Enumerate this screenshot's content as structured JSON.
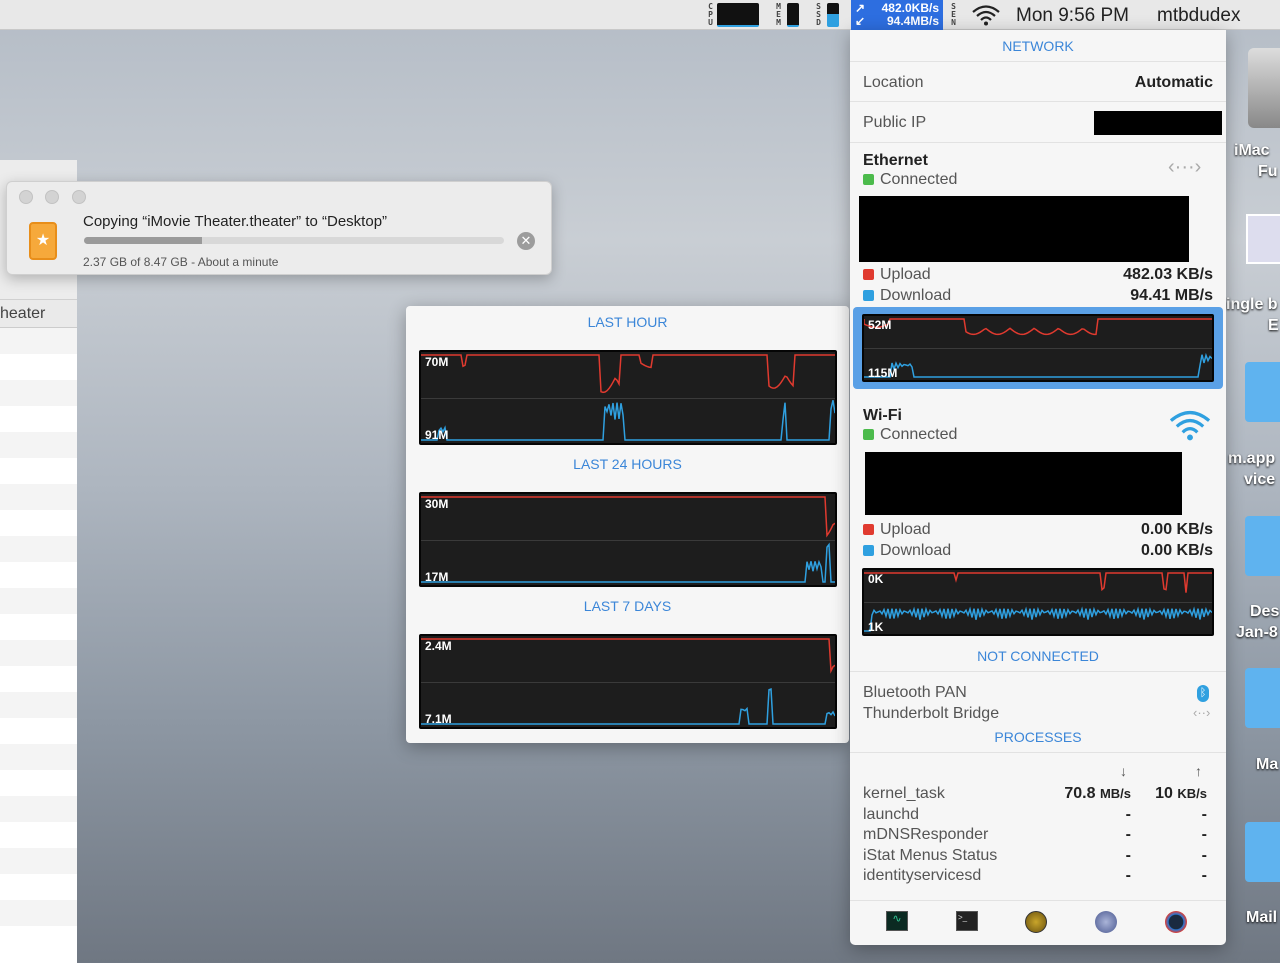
{
  "menubar": {
    "cpu_label": "CPU",
    "mem_label": "MEM",
    "ssd_label": "SSD",
    "sen_label": "SEN",
    "net_up": "482.0KB/s",
    "net_down": "94.4MB/s",
    "clock": "Mon 9:56 PM",
    "user": "mtbdudex"
  },
  "finder": {
    "partial_label": "heater"
  },
  "copy_dialog": {
    "title": "Copying “iMovie Theater.theater” to “Desktop”",
    "status": "2.37 GB of 8.47 GB - About a minute",
    "progress_fraction": 0.28
  },
  "history": {
    "sections": [
      {
        "title": "LAST HOUR",
        "top_label": "70M",
        "bottom_label": "91M"
      },
      {
        "title": "LAST 24 HOURS",
        "top_label": "30M",
        "bottom_label": "17M"
      },
      {
        "title": "LAST 7 DAYS",
        "top_label": "2.4M",
        "bottom_label": "7.1M"
      }
    ]
  },
  "network": {
    "title": "NETWORK",
    "location_label": "Location",
    "location_value": "Automatic",
    "public_ip_label": "Public IP",
    "ethernet": {
      "name": "Ethernet",
      "status": "Connected",
      "upload_label": "Upload",
      "upload_value": "482.03 KB/s",
      "download_label": "Download",
      "download_value": "94.41 MB/s",
      "graph_top": "52M",
      "graph_bottom": "115M"
    },
    "wifi": {
      "name": "Wi-Fi",
      "status": "Connected",
      "upload_label": "Upload",
      "upload_value": "0.00 KB/s",
      "download_label": "Download",
      "download_value": "0.00 KB/s",
      "graph_top": "0K",
      "graph_bottom": "1K"
    },
    "not_connected_title": "NOT CONNECTED",
    "not_connected": [
      "Bluetooth PAN",
      "Thunderbolt Bridge"
    ],
    "processes_title": "PROCESSES",
    "processes": [
      {
        "name": "kernel_task",
        "down": "70.8",
        "down_unit": "MB/s",
        "up": "10",
        "up_unit": "KB/s"
      },
      {
        "name": "launchd",
        "down": "-",
        "down_unit": "",
        "up": "-",
        "up_unit": ""
      },
      {
        "name": "mDNSResponder",
        "down": "-",
        "down_unit": "",
        "up": "-",
        "up_unit": ""
      },
      {
        "name": "iStat Menus Status",
        "down": "-",
        "down_unit": "",
        "up": "-",
        "up_unit": ""
      },
      {
        "name": "identityservicesd",
        "down": "-",
        "down_unit": "",
        "up": "-",
        "up_unit": ""
      }
    ],
    "footer_icons": [
      "activity-monitor-icon",
      "terminal-icon",
      "network-radar-icon",
      "network-utility-icon",
      "speed-test-icon"
    ]
  },
  "desktop_labels": [
    "iMac",
    "Fu",
    "ingle b",
    "E",
    "m.app",
    "vice",
    "Des",
    "Jan-8",
    "Ma",
    "Mail"
  ],
  "colors": {
    "accent": "#3b86d8",
    "upload": "#e03a2f",
    "download": "#2fa0e0",
    "status_green": "#4cbb4c"
  }
}
